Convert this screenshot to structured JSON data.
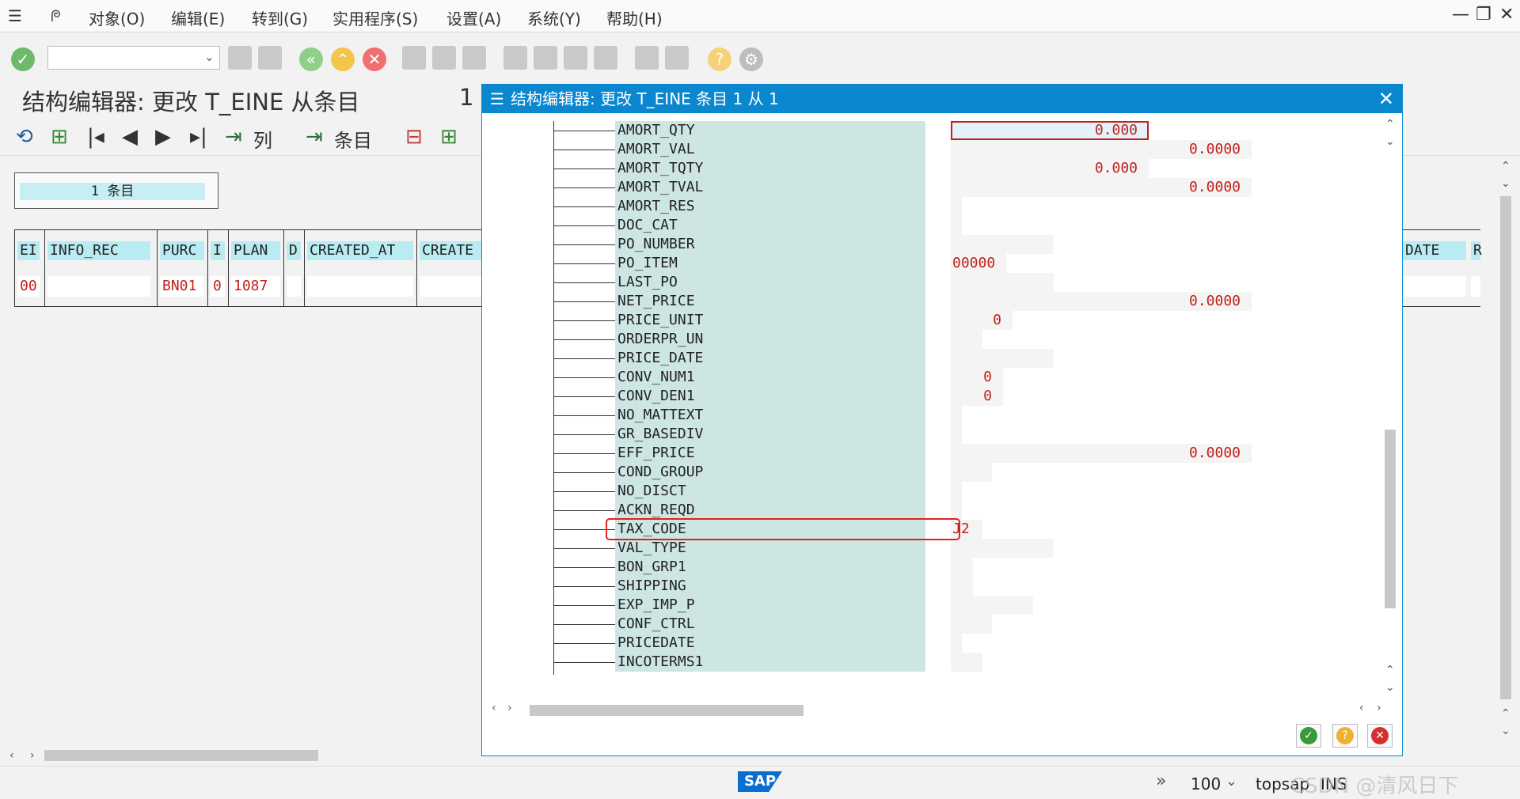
{
  "menu": [
    "对象(O)",
    "编辑(E)",
    "转到(G)",
    "实用程序(S)",
    "设置(A)",
    "系统(Y)",
    "帮助(H)"
  ],
  "window_controls": {
    "minimize": "—",
    "restore": "❐",
    "close": "✕"
  },
  "title": "结构编辑器: 更改 T_EINE 从条目",
  "title_count": "1",
  "app_toolbar": {
    "columns_label": "列",
    "entries_label": "条目"
  },
  "entries_box": "1 条目",
  "table": {
    "headers": [
      "EI",
      "INFO_REC",
      "PURC",
      "I",
      "PLAN",
      "D",
      "CREATED_AT",
      "CREATE",
      "DATE",
      "R"
    ],
    "row": [
      "00",
      "",
      "BN01",
      "0",
      "1087",
      "",
      "",
      "",
      "",
      ""
    ]
  },
  "dialog": {
    "title": "结构编辑器: 更改 T_EINE 条目 1 从 1",
    "close": "✕",
    "fields": [
      {
        "name": "AMORT_QTY",
        "value": "0.000"
      },
      {
        "name": "AMORT_VAL",
        "value": "0.0000"
      },
      {
        "name": "AMORT_TQTY",
        "value": "0.000"
      },
      {
        "name": "AMORT_TVAL",
        "value": "0.0000"
      },
      {
        "name": "AMORT_RES",
        "value": ""
      },
      {
        "name": "DOC_CAT",
        "value": ""
      },
      {
        "name": "PO_NUMBER",
        "value": ""
      },
      {
        "name": "PO_ITEM",
        "value": "00000"
      },
      {
        "name": "LAST_PO",
        "value": ""
      },
      {
        "name": "NET_PRICE",
        "value": "0.0000"
      },
      {
        "name": "PRICE_UNIT",
        "value": "0"
      },
      {
        "name": "ORDERPR_UN",
        "value": ""
      },
      {
        "name": "PRICE_DATE",
        "value": ""
      },
      {
        "name": "CONV_NUM1",
        "value": "0"
      },
      {
        "name": "CONV_DEN1",
        "value": "0"
      },
      {
        "name": "NO_MATTEXT",
        "value": ""
      },
      {
        "name": "GR_BASEDIV",
        "value": ""
      },
      {
        "name": "EFF_PRICE",
        "value": "0.0000"
      },
      {
        "name": "COND_GROUP",
        "value": ""
      },
      {
        "name": "NO_DISCT",
        "value": ""
      },
      {
        "name": "ACKN_REQD",
        "value": ""
      },
      {
        "name": "TAX_CODE",
        "value": "J2"
      },
      {
        "name": "VAL_TYPE",
        "value": ""
      },
      {
        "name": "BON_GRP1",
        "value": ""
      },
      {
        "name": "SHIPPING",
        "value": ""
      },
      {
        "name": "EXP_IMP_P",
        "value": ""
      },
      {
        "name": "CONF_CTRL",
        "value": ""
      },
      {
        "name": "PRICEDATE",
        "value": ""
      },
      {
        "name": "INCOTERMS1",
        "value": ""
      }
    ]
  },
  "status": {
    "zoom": "100",
    "server": "topsap",
    "mode": "INS",
    "brand": "SAP",
    "watermark": "CSDN @清风日下"
  },
  "colors": {
    "accent": "#0b87d0",
    "value_red": "#c0211a",
    "field_teal": "#cde6e4",
    "highlight": "#e02020"
  }
}
